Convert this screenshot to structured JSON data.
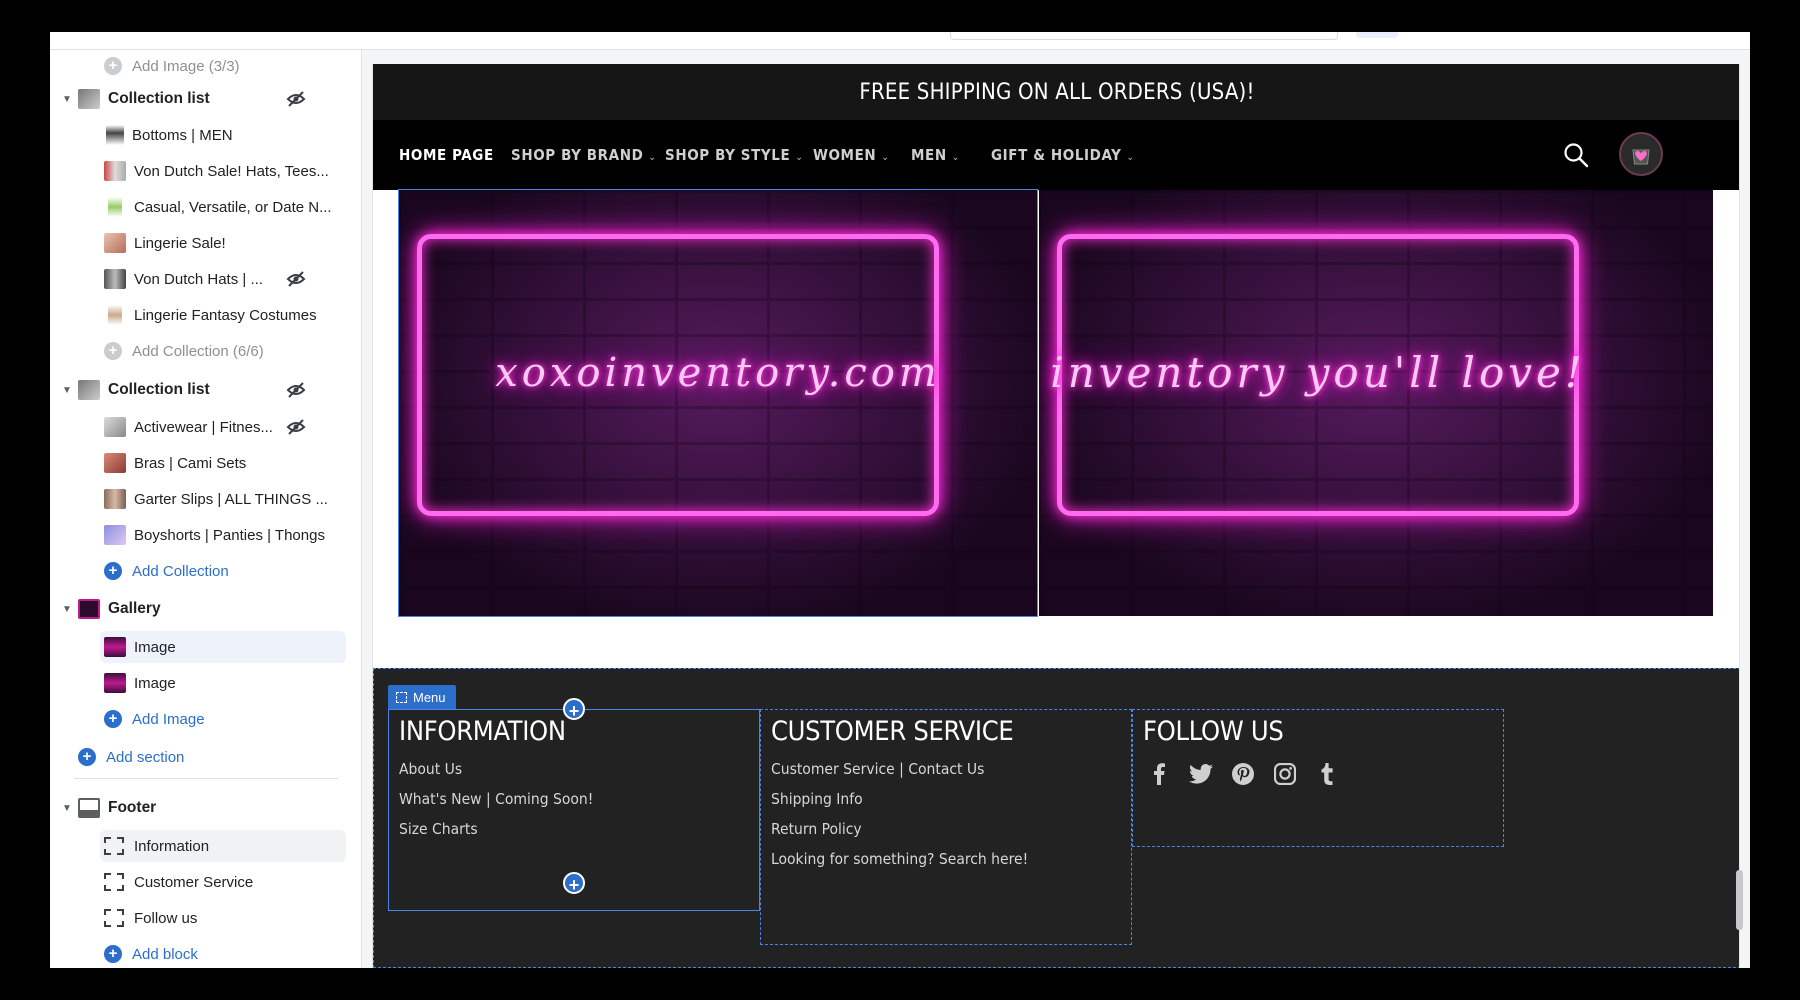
{
  "sidebar": {
    "items": [
      {
        "label": "Add Image (3/3)"
      },
      {
        "label": "Collection list"
      },
      {
        "label": "Bottoms | MEN"
      },
      {
        "label": "Von Dutch Sale! Hats, Tees..."
      },
      {
        "label": "Casual, Versatile, or Date N..."
      },
      {
        "label": "Lingerie Sale!"
      },
      {
        "label": "Von Dutch Hats | ..."
      },
      {
        "label": "Lingerie Fantasy Costumes"
      },
      {
        "label": "Add Collection (6/6)"
      },
      {
        "label": "Collection list"
      },
      {
        "label": "Activewear | Fitnes..."
      },
      {
        "label": "Bras | Cami Sets"
      },
      {
        "label": "Garter Slips | ALL THINGS ..."
      },
      {
        "label": "Boyshorts | Panties | Thongs"
      },
      {
        "label": "Add Collection"
      },
      {
        "label": "Gallery"
      },
      {
        "label": "Image"
      },
      {
        "label": "Image"
      },
      {
        "label": "Add Image"
      },
      {
        "label": "Add section"
      },
      {
        "label": "Footer"
      },
      {
        "label": "Information"
      },
      {
        "label": "Customer Service"
      },
      {
        "label": "Follow us"
      },
      {
        "label": "Add block"
      }
    ]
  },
  "store": {
    "announcement": "FREE SHIPPING ON ALL ORDERS (USA)!",
    "nav": [
      "HOME PAGE",
      "SHOP BY BRAND",
      "SHOP BY STYLE",
      "WOMEN",
      "MEN",
      "GIFT & HOLIDAY"
    ],
    "gallery": {
      "left_text": "xoxoinventory.com",
      "right_text": "inventory you'll love!"
    },
    "footer": {
      "menu_tag": "Menu",
      "columns": [
        {
          "title": "INFORMATION",
          "links": [
            "About Us",
            "What's New | Coming Soon!",
            "Size Charts"
          ]
        },
        {
          "title": "CUSTOMER SERVICE",
          "links": [
            "Customer Service | Contact Us",
            "Shipping Info",
            "Return Policy",
            "Looking for something? Search here!"
          ]
        },
        {
          "title": "FOLLOW US",
          "icons": [
            "facebook-icon",
            "twitter-icon",
            "pinterest-icon",
            "instagram-icon",
            "tumblr-icon"
          ]
        }
      ]
    }
  },
  "colors": {
    "accent": "#2c6ecb",
    "neon": "#ff2fd8",
    "footer_bg": "#222222"
  }
}
